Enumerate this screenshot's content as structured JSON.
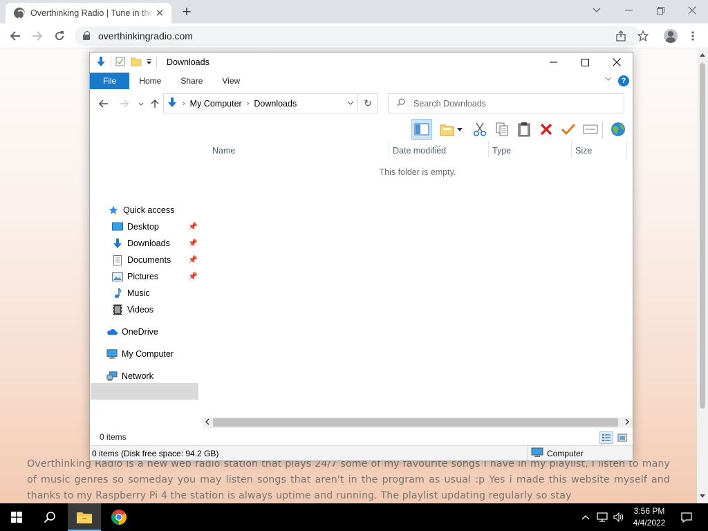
{
  "browser": {
    "tab_title": "Overthinking Radio | Tune in the",
    "url": "overthinkingradio.com"
  },
  "webpage": {
    "paragraph": "Overthinking Radio is a new web radio station that plays 24/7 some of my favourite songs I have in my playlist, I listen to many of music genres so someday you may listen songs that aren't in the program as usual :p Yes i made this website myself and thanks to my Raspberry Pi 4 the station is always uptime and running. The playlist updating regularly so stay"
  },
  "explorer": {
    "window_title": "Downloads",
    "ribbon_tabs": [
      "File",
      "Home",
      "Share",
      "View"
    ],
    "breadcrumb": [
      "My Computer",
      "Downloads"
    ],
    "search_placeholder": "Search Downloads",
    "columns": [
      "Name",
      "Date modified",
      "Type",
      "Size"
    ],
    "empty_message": "This folder is empty.",
    "nav": {
      "quick_access": "Quick access",
      "pinned": [
        "Desktop",
        "Downloads",
        "Documents",
        "Pictures"
      ],
      "unpinned": [
        "Music",
        "Videos"
      ],
      "onedrive": "OneDrive",
      "my_computer": "My Computer",
      "network": "Network"
    },
    "items_count": "0 items",
    "status_left": "0 items (Disk free space: 94.2 GB)",
    "status_right": "Computer"
  },
  "taskbar": {
    "time": "3:56 PM",
    "date": "4/4/2022"
  },
  "colors": {
    "accent": "#1979ca",
    "taskbar": "#000000",
    "page_gradient_bottom": "#f2c9b1"
  }
}
